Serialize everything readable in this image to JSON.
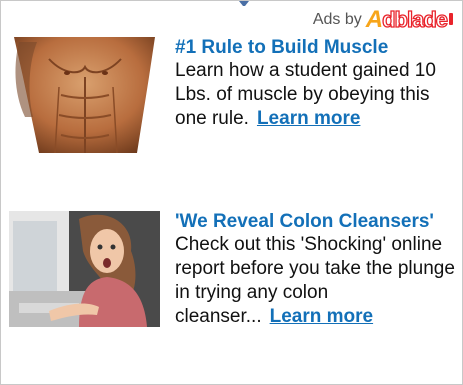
{
  "header": {
    "ads_by_label": "Ads by",
    "logo": {
      "text": "Adblade",
      "color_a": "#f7a51a",
      "color_rest": "#e9232b"
    }
  },
  "ads": [
    {
      "title": "#1 Rule to Build Muscle",
      "body": "Learn how a student gained 10 Lbs. of muscle by obeying this one rule.",
      "cta": "Learn more",
      "image": "muscle-torso-image"
    },
    {
      "title": "'We Reveal Colon Cleansers'",
      "body": "Check out this 'Shocking' online report before you take the plunge in trying any colon cleanser...",
      "cta": "Learn more",
      "image": "surprised-woman-at-computer-image"
    }
  ],
  "colors": {
    "link": "#1370b8",
    "text": "#111111",
    "border": "#c8c8c8"
  }
}
